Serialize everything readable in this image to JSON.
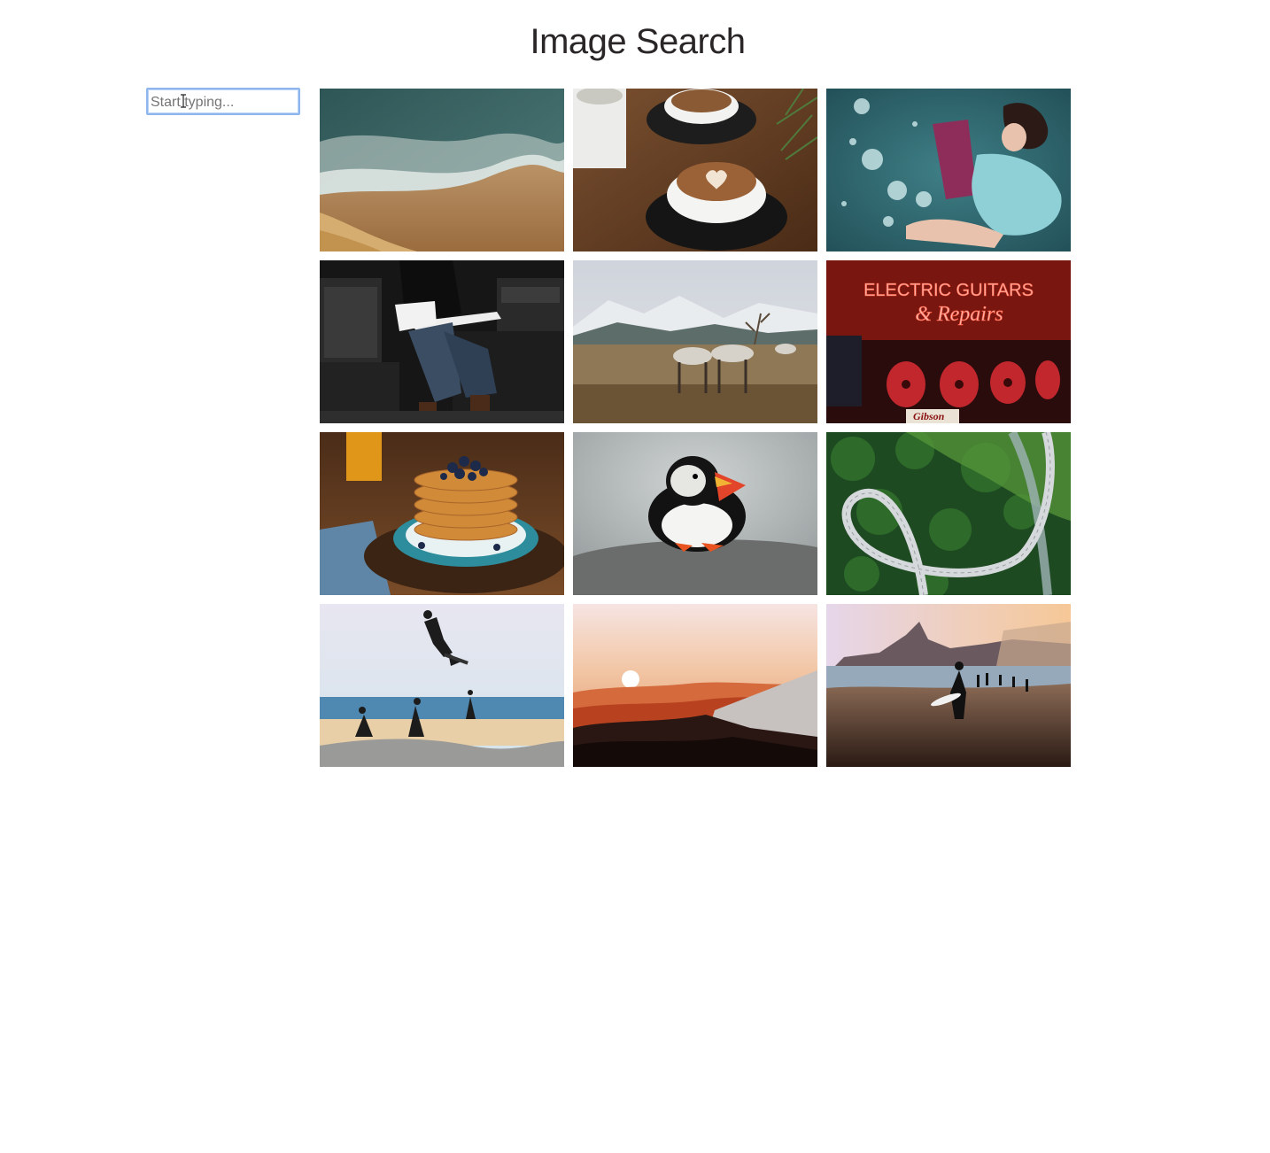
{
  "page": {
    "title": "Image Search"
  },
  "search": {
    "placeholder": "Start typing...",
    "value": ""
  },
  "gallery": {
    "images": [
      {
        "subject": "ocean-waves-beach"
      },
      {
        "subject": "latte-coffee-cups"
      },
      {
        "subject": "woman-reading-glitter"
      },
      {
        "subject": "guitarist-amplifiers"
      },
      {
        "subject": "reindeer-mountains"
      },
      {
        "subject": "electric-guitars-shop"
      },
      {
        "subject": "blueberry-pancakes"
      },
      {
        "subject": "puffin-rock"
      },
      {
        "subject": "winding-road-forest"
      },
      {
        "subject": "skateboarder-jump"
      },
      {
        "subject": "mountain-sunset"
      },
      {
        "subject": "beach-surfer-sunset"
      }
    ],
    "shop_sign": {
      "line1": "ELECTRIC GUITARS",
      "line2": "& Repairs",
      "brand": "Gibson"
    }
  }
}
